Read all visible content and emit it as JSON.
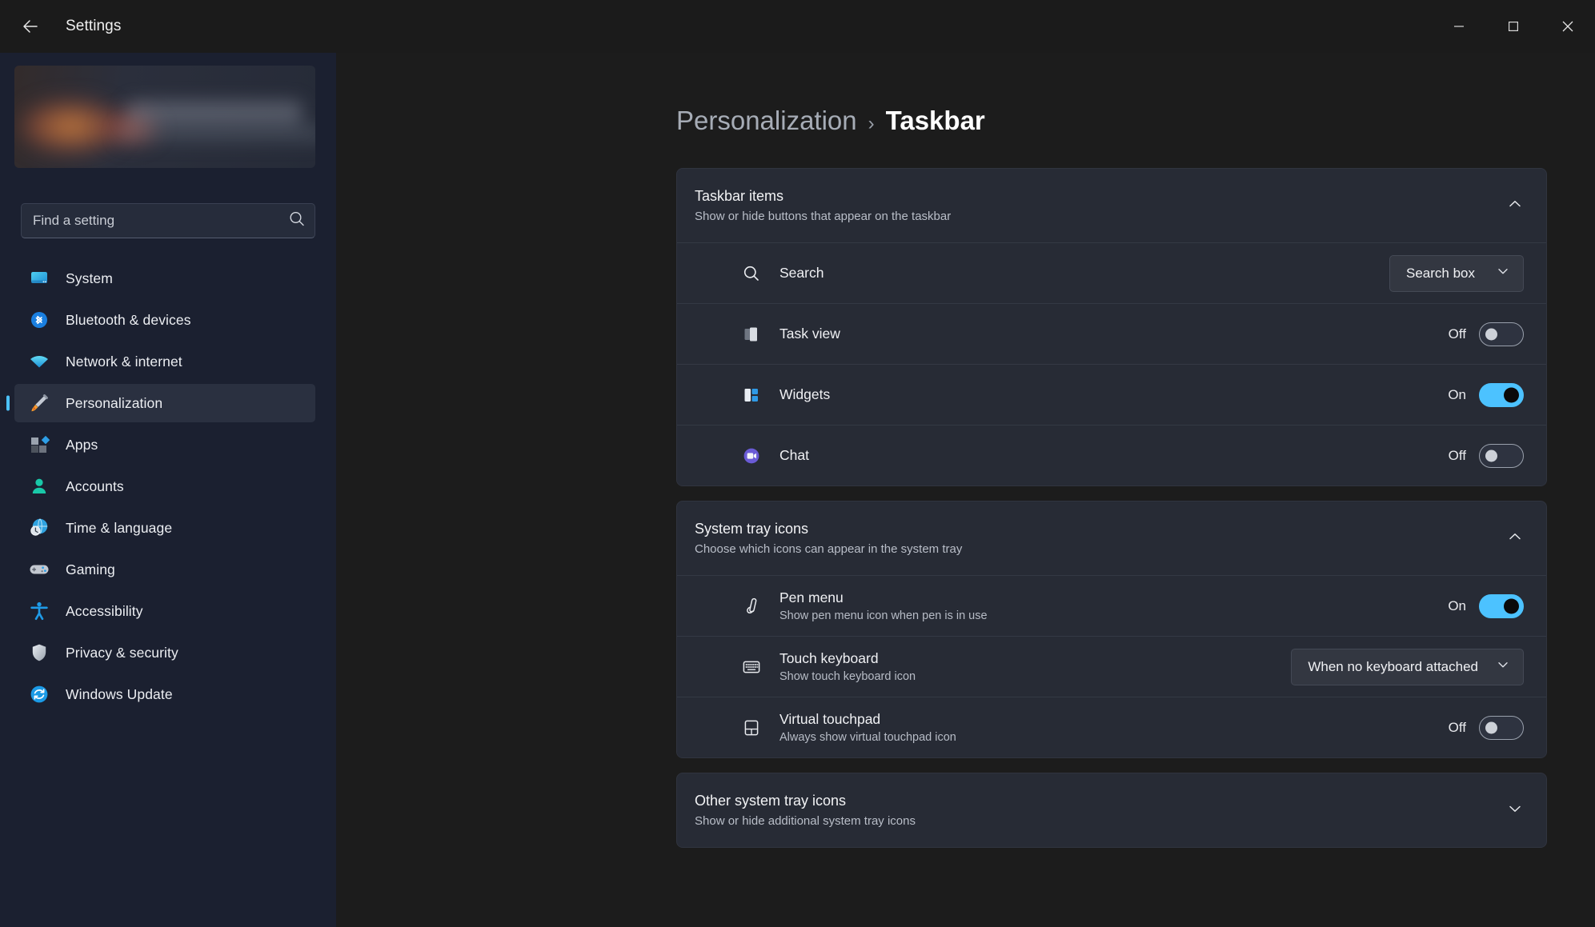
{
  "window": {
    "app_title": "Settings",
    "back_label": "Back",
    "controls": {
      "minimize": "Minimize",
      "maximize": "Maximize",
      "close": "Close"
    }
  },
  "sidebar": {
    "search": {
      "placeholder": "Find a setting",
      "value": ""
    },
    "items": [
      {
        "label": "System",
        "icon": "monitor-icon",
        "active": false
      },
      {
        "label": "Bluetooth & devices",
        "icon": "bluetooth-icon",
        "active": false
      },
      {
        "label": "Network & internet",
        "icon": "wifi-icon",
        "active": false
      },
      {
        "label": "Personalization",
        "icon": "paintbrush-icon",
        "active": true
      },
      {
        "label": "Apps",
        "icon": "apps-icon",
        "active": false
      },
      {
        "label": "Accounts",
        "icon": "person-icon",
        "active": false
      },
      {
        "label": "Time & language",
        "icon": "clock-globe-icon",
        "active": false
      },
      {
        "label": "Gaming",
        "icon": "gamepad-icon",
        "active": false
      },
      {
        "label": "Accessibility",
        "icon": "accessibility-icon",
        "active": false
      },
      {
        "label": "Privacy & security",
        "icon": "shield-icon",
        "active": false
      },
      {
        "label": "Windows Update",
        "icon": "update-icon",
        "active": false
      }
    ]
  },
  "breadcrumb": {
    "parent": "Personalization",
    "separator": "›",
    "current": "Taskbar"
  },
  "sections": [
    {
      "id": "taskbar-items",
      "title": "Taskbar items",
      "subtitle": "Show or hide buttons that appear on the taskbar",
      "expanded": true,
      "chevron": "chevron-up-icon",
      "rows": [
        {
          "title": "Search",
          "subtitle": "",
          "icon": "search-icon",
          "control": "dropdown",
          "value": "Search box"
        },
        {
          "title": "Task view",
          "subtitle": "",
          "icon": "task-view-icon",
          "control": "toggle",
          "state": "Off",
          "on": false
        },
        {
          "title": "Widgets",
          "subtitle": "",
          "icon": "widgets-icon",
          "control": "toggle",
          "state": "On",
          "on": true
        },
        {
          "title": "Chat",
          "subtitle": "",
          "icon": "chat-icon",
          "control": "toggle",
          "state": "Off",
          "on": false
        }
      ]
    },
    {
      "id": "system-tray-icons",
      "title": "System tray icons",
      "subtitle": "Choose which icons can appear in the system tray",
      "expanded": true,
      "chevron": "chevron-up-icon",
      "rows": [
        {
          "title": "Pen menu",
          "subtitle": "Show pen menu icon when pen is in use",
          "icon": "pen-icon",
          "control": "toggle",
          "state": "On",
          "on": true
        },
        {
          "title": "Touch keyboard",
          "subtitle": "Show touch keyboard icon",
          "icon": "keyboard-icon",
          "control": "dropdown",
          "value": "When no keyboard attached"
        },
        {
          "title": "Virtual touchpad",
          "subtitle": "Always show virtual touchpad icon",
          "icon": "touchpad-icon",
          "control": "toggle",
          "state": "Off",
          "on": false
        }
      ]
    },
    {
      "id": "other-system-tray-icons",
      "title": "Other system tray icons",
      "subtitle": "Show or hide additional system tray icons",
      "expanded": false,
      "chevron": "chevron-down-icon",
      "rows": []
    }
  ],
  "colors": {
    "accent": "#4cc2ff",
    "page_bg": "#1c1c1c",
    "sidebar_bg": "#1b2030",
    "card_bg": "#272b35"
  }
}
